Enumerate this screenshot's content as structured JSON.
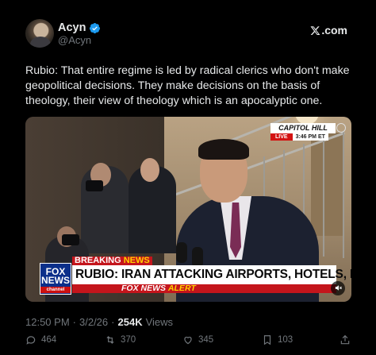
{
  "author": {
    "name": "Acyn",
    "handle": "@Acyn",
    "verified": true
  },
  "brand": {
    "label": ".com"
  },
  "tweet": {
    "text": "Rubio: That entire regime is led by radical clerics who don't make geopolitical decisions. They make decisions on the basis of theology, their view of theology which is an apocalyptic one."
  },
  "video": {
    "location": "CAPITOL HILL",
    "live": "LIVE",
    "time": "3:46 PM ET",
    "network": "FOX",
    "network_line2": "NEWS",
    "network_sub": "channel",
    "breaking_word1": "BREAKING",
    "breaking_word2": "NEWS",
    "headline": "RUBIO: IRAN ATTACKING AIRPORTS, HOTELS, EMBASSIES",
    "alert_word1": "FOX NEWS",
    "alert_word2": "ALERT"
  },
  "meta": {
    "time": "12:50 PM",
    "separator": "·",
    "date": "3/2/26",
    "separator2": "·",
    "views_count": "254K",
    "views_label": "Views"
  },
  "actions": {
    "replies": "464",
    "reposts": "370",
    "likes": "345",
    "bookmarks": "103"
  },
  "colors": {
    "background": "#000000",
    "text": "#e7e9ea",
    "muted": "#71767b",
    "verified": "#1d9bf0",
    "fox_red": "#c4151c"
  }
}
